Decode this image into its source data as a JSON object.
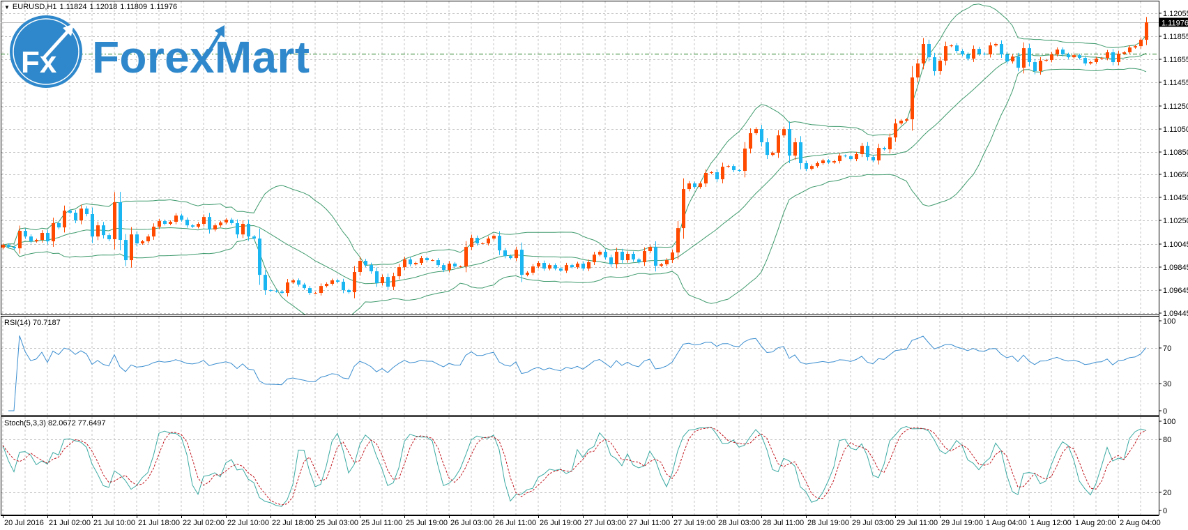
{
  "header": {
    "menu_icon": "triangle-down-icon",
    "symbol": "EURUSD,H1",
    "open": "1.11824",
    "high": "1.12018",
    "low": "1.11809",
    "close": "1.11976"
  },
  "watermark": {
    "icon_text": "Fx",
    "text": "ForexMart"
  },
  "rsi": {
    "label": "RSI(14) 70.7187"
  },
  "stoch": {
    "label": "Stoch(5,3,3) 82.0672 77.6497"
  },
  "colors": {
    "bull": "#ff4a00",
    "bear": "#19b6f2",
    "bollinger": "#3f9a6d",
    "rsi_line": "#3a8dcf",
    "stoch_main": "#3aa9a2",
    "stoch_signal": "#c0141c",
    "grid": "#c4c4c4",
    "level_line": "#1e7a1e",
    "logo": "#2f88cb"
  },
  "chart_data": {
    "type": "candlestick",
    "title": "EURUSD,H1",
    "first_open": 1.10015,
    "closes": [
      1.10039,
      1.10021,
      1.10009,
      1.10161,
      1.10112,
      1.1007,
      1.10082,
      1.10143,
      1.1007,
      1.10228,
      1.10191,
      1.10337,
      1.10319,
      1.10252,
      1.10355,
      1.10307,
      1.10112,
      1.10209,
      1.10124,
      1.10088,
      1.1041,
      1.10082,
      1.09906,
      1.1013,
      1.10052,
      1.1007,
      1.10112,
      1.10197,
      1.10246,
      1.10222,
      1.1024,
      1.10294,
      1.10258,
      1.10209,
      1.10197,
      1.10222,
      1.10282,
      1.10173,
      1.10209,
      1.10234,
      1.10258,
      1.10228,
      1.1013,
      1.10222,
      1.10112,
      1.10094,
      1.09778,
      1.09645,
      1.09639,
      1.09633,
      1.09621,
      1.09712,
      1.0973,
      1.09693,
      1.09663,
      1.09621,
      1.09621,
      1.09681,
      1.097,
      1.0973,
      1.09718,
      1.09645,
      1.09627,
      1.09803,
      1.099,
      1.09863,
      1.09809,
      1.09706,
      1.0976,
      1.09675,
      1.09766,
      1.09845,
      1.09912,
      1.0987,
      1.09882,
      1.09924,
      1.09906,
      1.09906,
      1.09863,
      1.09821,
      1.09876,
      1.09851,
      1.09851,
      1.10021,
      1.101,
      1.10052,
      1.10052,
      1.10094,
      1.10118,
      1.09991,
      1.09942,
      1.09924,
      1.09997,
      1.09778,
      1.09797,
      1.09851,
      1.09882,
      1.09833,
      1.09863,
      1.09833,
      1.09815,
      1.09863,
      1.09845,
      1.09876,
      1.09833,
      1.09888,
      1.09954,
      1.09979,
      1.0993,
      1.0987,
      1.09979,
      1.09906,
      1.09961,
      1.09912,
      1.09888,
      1.09985,
      1.10021,
      1.09857,
      1.0987,
      1.09906,
      1.09973,
      1.10185,
      1.10525,
      1.10574,
      1.10543,
      1.10574,
      1.10665,
      1.10671,
      1.1061,
      1.10719,
      1.10725,
      1.10689,
      1.10683,
      1.10877,
      1.11011,
      1.11047,
      1.10932,
      1.10822,
      1.10841,
      1.10992,
      1.11047,
      1.10816,
      1.10932,
      1.1075,
      1.10701,
      1.10725,
      1.1075,
      1.10774,
      1.10756,
      1.10768,
      1.10816,
      1.1081,
      1.10786,
      1.10829,
      1.10901,
      1.10804,
      1.10774,
      1.10883,
      1.10871,
      1.10974,
      1.11096,
      1.1112,
      1.11132,
      1.11496,
      1.11618,
      1.11788,
      1.11672,
      1.11551,
      1.11642,
      1.11769,
      1.11775,
      1.11727,
      1.11697,
      1.1166,
      1.11745,
      1.11703,
      1.11697,
      1.11775,
      1.11788,
      1.11697,
      1.11636,
      1.11678,
      1.11581,
      1.11751,
      1.1163,
      1.11551,
      1.11642,
      1.11648,
      1.11697,
      1.11739,
      1.11697,
      1.11672,
      1.1169,
      1.11666,
      1.11618,
      1.1163,
      1.1166,
      1.11666,
      1.11715,
      1.1163,
      1.11703,
      1.11715,
      1.11757,
      1.11769,
      1.11824,
      1.11976
    ],
    "price_ticks": [
      "1.12055",
      "1.11855",
      "1.11655",
      "1.11455",
      "1.11250",
      "1.11050",
      "1.10850",
      "1.10650",
      "1.10450",
      "1.10250",
      "1.10045",
      "1.09845",
      "1.09645",
      "1.09445"
    ],
    "current_price": "1.11976",
    "level_line": 1.117,
    "ylim": [
      1.09425,
      1.1217
    ],
    "time_labels": [
      "20 Jul 2016",
      "21 Jul 02:00",
      "21 Jul 10:00",
      "21 Jul 18:00",
      "22 Jul 02:00",
      "22 Jul 10:00",
      "22 Jul 18:00",
      "25 Jul 03:00",
      "25 Jul 11:00",
      "25 Jul 19:00",
      "26 Jul 03:00",
      "26 Jul 11:00",
      "26 Jul 19:00",
      "27 Jul 03:00",
      "27 Jul 11:00",
      "27 Jul 19:00",
      "28 Jul 03:00",
      "28 Jul 11:00",
      "28 Jul 19:00",
      "29 Jul 03:00",
      "29 Jul 11:00",
      "29 Jul 19:00",
      "1 Aug 04:00",
      "1 Aug 12:00",
      "1 Aug 20:00",
      "2 Aug 04:00"
    ],
    "time_label_every_bars": 8,
    "indicators": {
      "bollinger": {
        "period": 20,
        "deviation": 2
      },
      "rsi": {
        "period": 14,
        "ticks": [
          "100",
          "70",
          "30",
          "0"
        ],
        "range": [
          0,
          100
        ]
      },
      "stoch": {
        "k": 5,
        "d": 3,
        "slowing": 3,
        "ticks": [
          "100",
          "80",
          "20",
          "0"
        ],
        "range": [
          0,
          100
        ]
      }
    }
  }
}
